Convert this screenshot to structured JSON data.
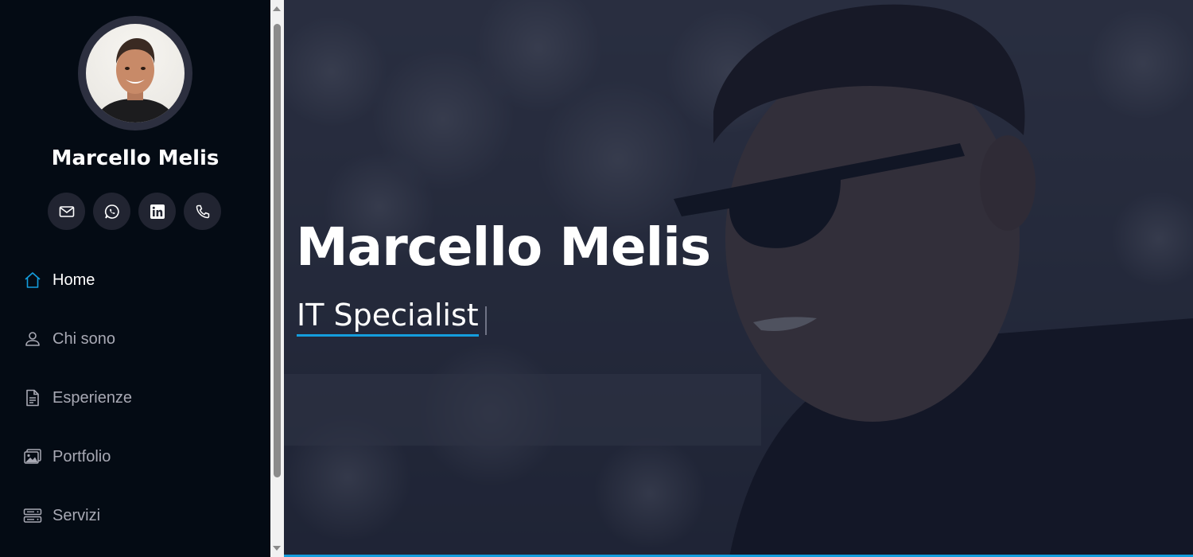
{
  "profile": {
    "name": "Marcello Melis"
  },
  "social": [
    {
      "icon": "envelope-icon"
    },
    {
      "icon": "whatsapp-icon"
    },
    {
      "icon": "linkedin-icon"
    },
    {
      "icon": "phone-icon"
    }
  ],
  "nav": {
    "items": [
      {
        "label": "Home",
        "icon": "house-icon",
        "active": true
      },
      {
        "label": "Chi sono",
        "icon": "person-icon",
        "active": false
      },
      {
        "label": "Esperienze",
        "icon": "document-icon",
        "active": false
      },
      {
        "label": "Portfolio",
        "icon": "images-icon",
        "active": false
      },
      {
        "label": "Servizi",
        "icon": "server-icon",
        "active": false
      }
    ]
  },
  "hero": {
    "title": "Marcello Melis",
    "subtitle": "IT Specialist"
  },
  "colors": {
    "sidebar_bg": "#040b14",
    "accent": "#149ddd",
    "nav_text": "#a8a9b4",
    "social_bg": "#212431"
  }
}
